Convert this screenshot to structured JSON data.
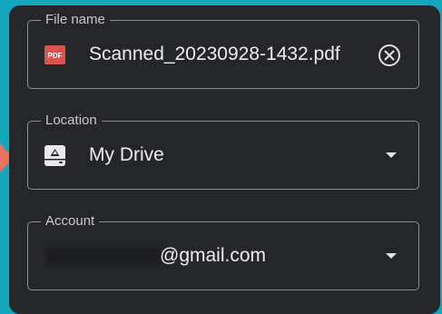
{
  "dialog": {
    "file_name": {
      "label": "File name",
      "value": "Scanned_20230928-1432.pdf",
      "file_icon": "pdf-file-icon",
      "file_icon_text": "PDF",
      "clear_icon": "clear-circle-x-icon"
    },
    "location": {
      "label": "Location",
      "value": "My Drive",
      "icon": "google-drive-icon",
      "dropdown_icon": "dropdown-arrow-icon"
    },
    "account": {
      "label": "Account",
      "value": "@gmail.com",
      "dropdown_icon": "dropdown-arrow-icon"
    }
  },
  "colors": {
    "background": "#14a6bd",
    "dialog": "#252628",
    "pointer": "#e9725f",
    "pdf_icon": "#d9534f"
  }
}
